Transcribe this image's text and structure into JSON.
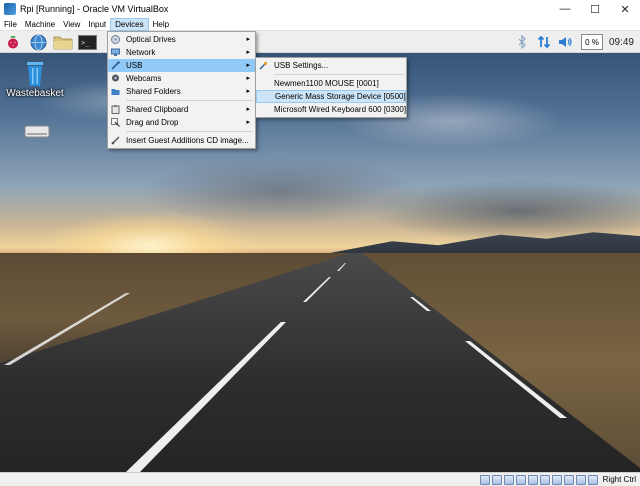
{
  "window": {
    "title": "Rpi [Running] - Oracle VM VirtualBox",
    "minimize": "—",
    "maximize": "☐",
    "close": "✕"
  },
  "menubar": [
    "File",
    "Machine",
    "View",
    "Input",
    "Devices",
    "Help"
  ],
  "guest": {
    "tray": {
      "bluetooth": "⚡",
      "network": "⇅",
      "volume": "🔈",
      "cpu": "0 %",
      "clock": "09:49"
    },
    "desktop_icons": [
      {
        "label": "Wastebasket",
        "icon": "trash-icon"
      },
      {
        "label": "",
        "icon": "drive-icon"
      }
    ]
  },
  "devices_menu": [
    {
      "label": "Optical Drives",
      "icon": "disc-icon",
      "submenu": true
    },
    {
      "label": "Network",
      "icon": "network-icon",
      "submenu": true
    },
    {
      "label": "USB",
      "icon": "usb-icon",
      "submenu": true,
      "highlighted": true
    },
    {
      "label": "Webcams",
      "icon": "webcam-icon",
      "submenu": true
    },
    {
      "label": "Shared Folders",
      "icon": "folder-icon",
      "submenu": true
    },
    {
      "label": "Shared Clipboard",
      "icon": "clipboard-icon",
      "submenu": true
    },
    {
      "label": "Drag and Drop",
      "icon": "drag-icon",
      "submenu": true
    },
    {
      "label": "Insert Guest Additions CD image...",
      "icon": "cd-icon",
      "submenu": false
    }
  ],
  "usb_menu": [
    {
      "label": "USB Settings...",
      "icon": "usb-settings-icon"
    },
    {
      "label": "Newmen1100 MOUSE [0001]"
    },
    {
      "label": "Generic Mass Storage Device [0500]",
      "highlighted": true
    },
    {
      "label": "Microsoft Wired Keyboard 600 [0300]"
    }
  ],
  "statusbar": {
    "host_key": "Right Ctrl"
  }
}
